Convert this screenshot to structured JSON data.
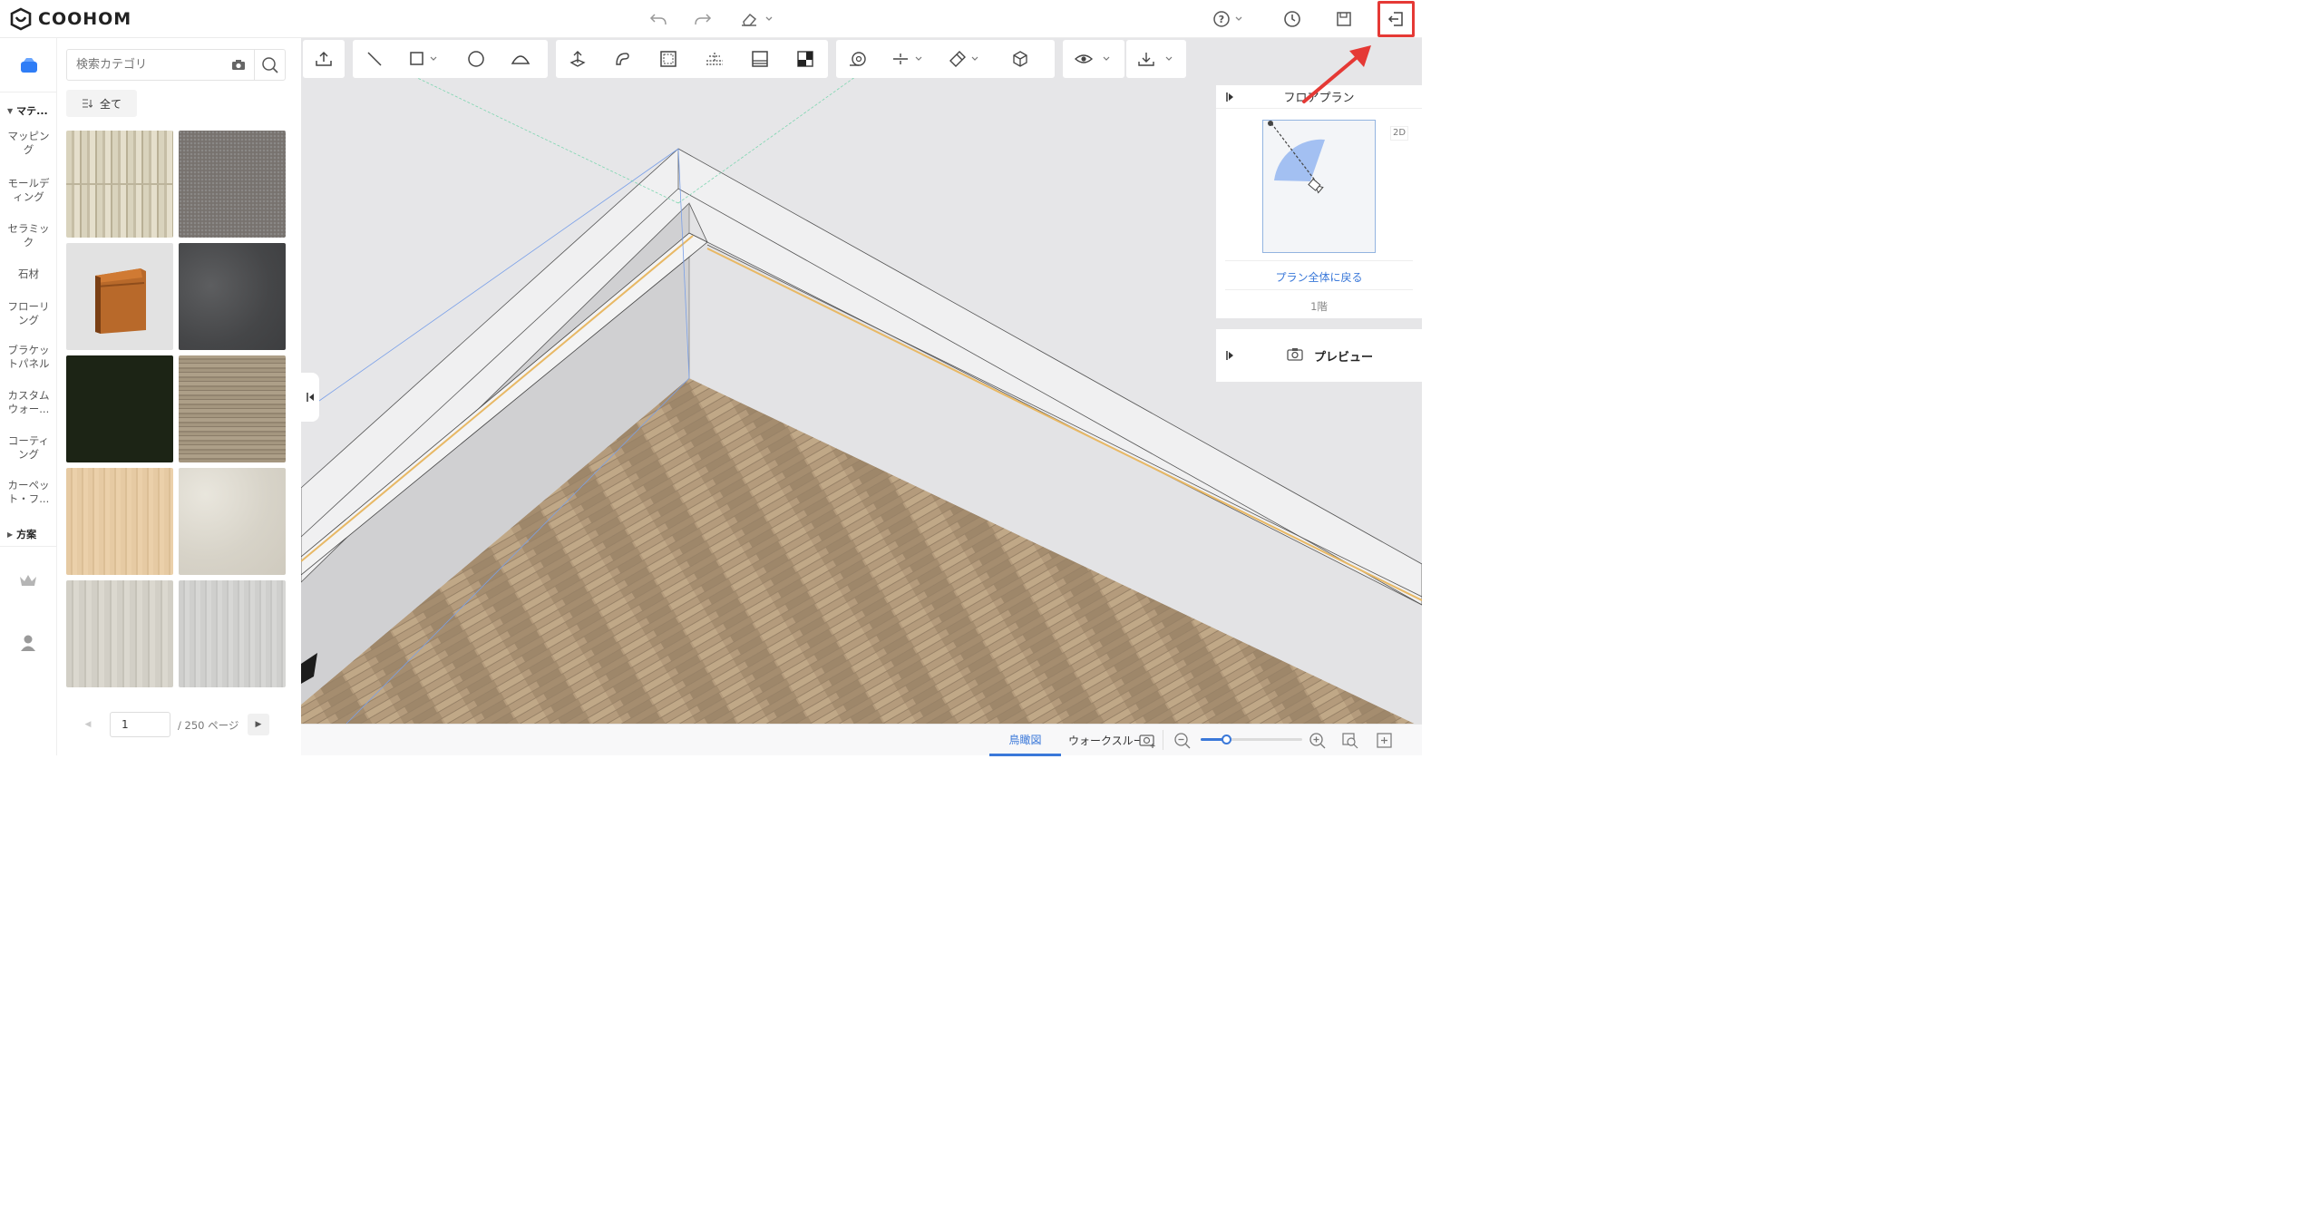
{
  "app": {
    "logo_text": "COOHOM"
  },
  "topbar": {
    "icons": [
      "undo-icon",
      "redo-icon",
      "eraser-icon",
      "help-icon",
      "history-icon",
      "save-icon",
      "exit-icon"
    ],
    "highlight_color": "#e53935"
  },
  "rail": {
    "section_material": "マテ...",
    "items": [
      "マッピング",
      "モールディング",
      "セラミック",
      "石材",
      "フローリング",
      "ブラケットパネル",
      "カスタムウォー...",
      "コーティング",
      "カーペット・フ..."
    ],
    "section_plan": "方案"
  },
  "panel": {
    "search_placeholder": "検索カテゴリ",
    "all_label": "全て",
    "tiles": [
      "wood-birch",
      "carpet-gray",
      "molding-orange",
      "concrete-dark",
      "solid-dark-green",
      "wood-gray-oak",
      "wood-light-maple",
      "marble-cream",
      "wood-white-ash",
      "wood-light-gray"
    ],
    "page_current": "1",
    "page_total": "/ 250 ページ"
  },
  "floorplan": {
    "title": "フロアプラン",
    "mode_label": "2D",
    "back_link": "プラン全体に戻る",
    "floor_label": "1階"
  },
  "preview": {
    "label": "プレビュー"
  },
  "bottom": {
    "tab_birdseye": "鳥瞰図",
    "tab_walkthrough": "ウォークスルー",
    "zoom_level": 0.25,
    "accent": "#3a78d9"
  }
}
